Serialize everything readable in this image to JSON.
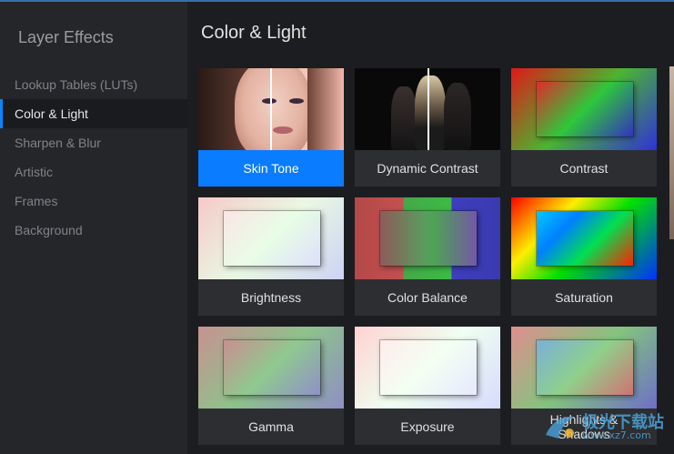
{
  "sidebar": {
    "title": "Layer Effects",
    "items": [
      {
        "label": "Lookup Tables (LUTs)",
        "active": false
      },
      {
        "label": "Color & Light",
        "active": true
      },
      {
        "label": "Sharpen & Blur",
        "active": false
      },
      {
        "label": "Artistic",
        "active": false
      },
      {
        "label": "Frames",
        "active": false
      },
      {
        "label": "Background",
        "active": false
      }
    ]
  },
  "main": {
    "title": "Color & Light",
    "cards": [
      {
        "label": "Skin Tone",
        "selected": true
      },
      {
        "label": "Dynamic Contrast",
        "selected": false
      },
      {
        "label": "Contrast",
        "selected": false
      },
      {
        "label": "Brightness",
        "selected": false
      },
      {
        "label": "Color Balance",
        "selected": false
      },
      {
        "label": "Saturation",
        "selected": false
      },
      {
        "label": "Gamma",
        "selected": false
      },
      {
        "label": "Exposure",
        "selected": false
      },
      {
        "label": "Highlights & Shadows",
        "selected": false
      }
    ]
  },
  "watermark": {
    "main": "极光下载站",
    "sub": "www.xz7.com"
  },
  "colors": {
    "accent": "#0a7cff",
    "sidebar_bg": "#24262a",
    "main_bg": "#1c1d20",
    "card_bg": "#2d2e32"
  }
}
